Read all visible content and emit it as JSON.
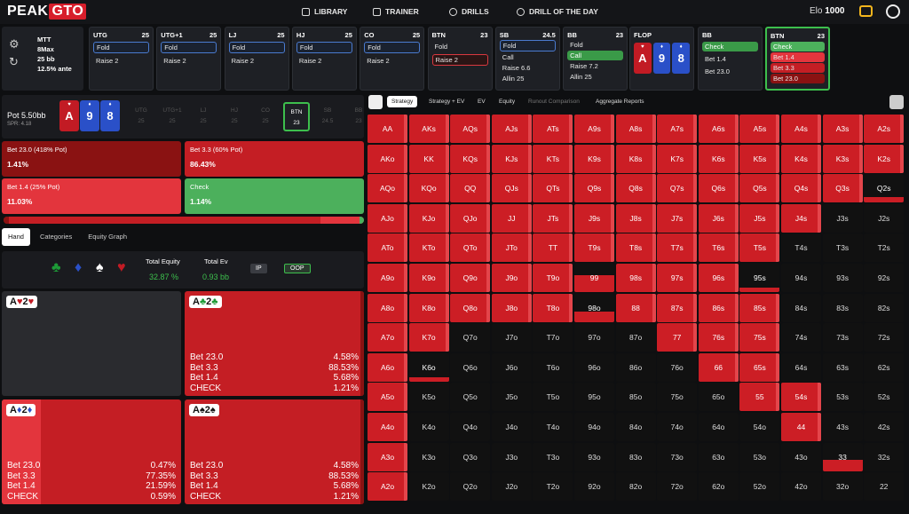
{
  "nav": {
    "logo_a": "PEAK",
    "logo_b": "GTO",
    "library": "LIBRARY",
    "trainer": "TRAINER",
    "drills": "DRILLS",
    "dotd": "DRILL OF THE DAY",
    "elo_label": "Elo",
    "elo_value": "1000"
  },
  "game": {
    "type": "MTT",
    "max": "8Max",
    "stack": "25 bb",
    "ante": "12.5% ante"
  },
  "positions": [
    {
      "name": "UTG",
      "stack": "25",
      "actions": [
        "Fold",
        "Raise 2"
      ],
      "sel": 0,
      "selclass": "sel"
    },
    {
      "name": "UTG+1",
      "stack": "25",
      "actions": [
        "Fold",
        "Raise 2"
      ],
      "sel": 0,
      "selclass": "sel"
    },
    {
      "name": "LJ",
      "stack": "25",
      "actions": [
        "Fold",
        "Raise 2"
      ],
      "sel": 0,
      "selclass": "sel"
    },
    {
      "name": "HJ",
      "stack": "25",
      "actions": [
        "Fold",
        "Raise 2"
      ],
      "sel": 0,
      "selclass": "sel"
    },
    {
      "name": "CO",
      "stack": "25",
      "actions": [
        "Fold",
        "Raise 2"
      ],
      "sel": 0,
      "selclass": "sel"
    },
    {
      "name": "BTN",
      "stack": "23",
      "actions": [
        "Fold",
        "Raise 2"
      ],
      "sel": 1,
      "selclass": "selr"
    },
    {
      "name": "SB",
      "stack": "24.5",
      "actions": [
        "Fold",
        "Call",
        "Raise 6.6",
        "Allin 25"
      ],
      "sel": 0,
      "selclass": "sel"
    },
    {
      "name": "BB",
      "stack": "23",
      "actions": [
        "Fold",
        "Call",
        "Raise 7.2",
        "Allin 25"
      ],
      "sel": 1,
      "selclass": "call"
    }
  ],
  "flop": {
    "label": "FLOP",
    "cards": [
      {
        "rank": "A",
        "suit": "h"
      },
      {
        "rank": "9",
        "suit": "d"
      },
      {
        "rank": "8",
        "suit": "d"
      }
    ]
  },
  "bb_box": {
    "name": "BB",
    "actions": [
      "Check",
      "Bet 1.4",
      "Bet 23.0"
    ]
  },
  "btn_box": {
    "name": "BTN",
    "stack": "23",
    "actions": [
      "Check",
      "Bet 1.4",
      "Bet 3.3",
      "Bet 23.0"
    ]
  },
  "pot": {
    "label": "Pot",
    "value": "5.50bb",
    "spr": "SPR: 4.18"
  },
  "seats": [
    {
      "n": "UTG",
      "s": "25"
    },
    {
      "n": "UTG+1",
      "s": "25"
    },
    {
      "n": "LJ",
      "s": "25"
    },
    {
      "n": "HJ",
      "s": "25"
    },
    {
      "n": "CO",
      "s": "25"
    },
    {
      "n": "BTN",
      "s": "23"
    },
    {
      "n": "SB",
      "s": "24.5"
    },
    {
      "n": "BB",
      "s": "23"
    }
  ],
  "actions": [
    {
      "label": "Bet 23.0 (418% Pot)",
      "pct": "1.41%",
      "color": "#8a1212"
    },
    {
      "label": "Bet 3.3 (60% Pot)",
      "pct": "86.43%",
      "color": "#c41e24"
    },
    {
      "label": "Bet 1.4 (25% Pot)",
      "pct": "11.03%",
      "color": "#e3353d"
    },
    {
      "label": "Check",
      "pct": "1.14%",
      "color": "#4cb05c"
    }
  ],
  "tabs": [
    "Hand",
    "Categories",
    "Equity Graph"
  ],
  "equity": {
    "total_equity_label": "Total Equity",
    "total_equity": "32.87 %",
    "total_ev_label": "Total Ev",
    "total_ev": "0.93 bb",
    "ip": "IP",
    "oop": "OOP"
  },
  "combos": [
    {
      "r1": "A",
      "s1": "♥",
      "c1": "r",
      "r2": "2",
      "s2": "♥",
      "c2": "r",
      "rows": []
    },
    {
      "r1": "A",
      "s1": "♣",
      "c1": "g",
      "r2": "2",
      "s2": "♣",
      "c2": "g",
      "rows": [
        [
          "Bet 23.0",
          "4.58%"
        ],
        [
          "Bet 3.3",
          "88.53%"
        ],
        [
          "Bet 1.4",
          "5.68%"
        ],
        [
          "CHECK",
          "1.21%"
        ]
      ]
    },
    {
      "r1": "A",
      "s1": "♦",
      "c1": "b",
      "r2": "2",
      "s2": "♦",
      "c2": "b",
      "rows": [
        [
          "Bet 23.0",
          "0.47%"
        ],
        [
          "Bet 3.3",
          "77.35%"
        ],
        [
          "Bet 1.4",
          "21.59%"
        ],
        [
          "CHECK",
          "0.59%"
        ]
      ]
    },
    {
      "r1": "A",
      "s1": "♠",
      "c1": "k",
      "r2": "2",
      "s2": "♠",
      "c2": "k",
      "rows": [
        [
          "Bet 23.0",
          "4.58%"
        ],
        [
          "Bet 3.3",
          "88.53%"
        ],
        [
          "Bet 1.4",
          "5.68%"
        ],
        [
          "CHECK",
          "1.21%"
        ]
      ]
    }
  ],
  "grid_tabs": [
    "Strategy",
    "Strategy + EV",
    "EV",
    "Equity",
    "Runout Comparison",
    "Aggregate Reports"
  ],
  "ranks": [
    "A",
    "K",
    "Q",
    "J",
    "T",
    "9",
    "8",
    "7",
    "6",
    "5",
    "4",
    "3",
    "2"
  ],
  "grid_freq": [
    [
      1,
      1,
      1,
      1,
      1,
      1,
      1,
      1,
      1,
      1,
      1,
      1,
      1
    ],
    [
      1,
      1,
      1,
      1,
      1,
      1,
      1,
      1,
      1,
      1,
      1,
      1,
      1
    ],
    [
      1,
      1,
      1,
      1,
      1,
      1,
      1,
      1,
      1,
      1,
      1,
      1,
      0.2
    ],
    [
      1,
      1,
      1,
      1,
      1,
      1,
      1,
      1,
      1,
      1,
      1,
      0,
      0
    ],
    [
      1,
      1,
      1,
      1,
      1,
      1,
      1,
      1,
      1,
      1,
      0,
      0,
      0
    ],
    [
      1,
      1,
      1,
      1,
      1,
      0.6,
      1,
      1,
      1,
      0.15,
      0,
      0,
      0
    ],
    [
      1,
      1,
      1,
      1,
      1,
      0.35,
      1,
      1,
      1,
      1,
      0,
      0,
      0
    ],
    [
      1,
      1,
      0,
      0,
      0,
      0,
      0,
      1,
      1,
      1,
      0,
      0,
      0
    ],
    [
      1,
      0.15,
      0,
      0,
      0,
      0,
      0,
      0,
      1,
      1,
      0,
      0,
      0
    ],
    [
      1,
      0,
      0,
      0,
      0,
      0,
      0,
      0,
      0,
      1,
      1,
      0,
      0
    ],
    [
      1,
      0,
      0,
      0,
      0,
      0,
      0,
      0,
      0,
      0,
      1,
      0,
      0
    ],
    [
      1,
      0,
      0,
      0,
      0,
      0,
      0,
      0,
      0,
      0,
      0,
      0.4,
      0
    ],
    [
      1,
      0,
      0,
      0,
      0,
      0,
      0,
      0,
      0,
      0,
      0,
      0,
      0
    ]
  ]
}
